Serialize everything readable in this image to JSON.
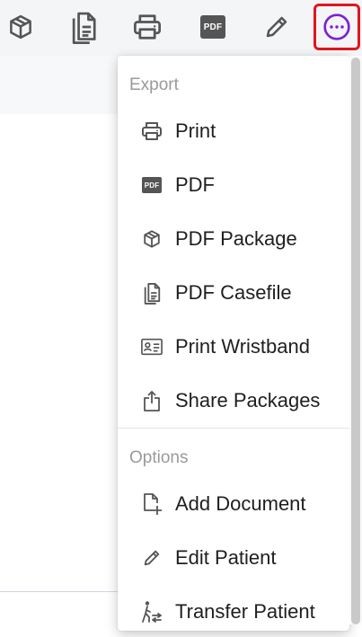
{
  "toolbar": {
    "buttons": [
      {
        "icon": "package-icon"
      },
      {
        "icon": "casefile-icon"
      },
      {
        "icon": "printer-icon"
      },
      {
        "icon": "pdf-icon",
        "badge_text": "PDF"
      },
      {
        "icon": "pencil-icon"
      },
      {
        "icon": "more-horizontal-icon",
        "highlight_color": "#e0161f",
        "accent_color": "#7b22d4"
      }
    ]
  },
  "menu": {
    "export_title": "Export",
    "export_items": [
      {
        "label": "Print",
        "icon": "printer-icon"
      },
      {
        "label": "PDF",
        "icon": "pdf-icon",
        "badge_text": "PDF"
      },
      {
        "label": "PDF Package",
        "icon": "package-icon"
      },
      {
        "label": "PDF Casefile",
        "icon": "casefile-icon"
      },
      {
        "label": "Print Wristband",
        "icon": "id-card-icon"
      },
      {
        "label": "Share Packages",
        "icon": "share-icon"
      }
    ],
    "options_title": "Options",
    "options_items": [
      {
        "label": "Add Document",
        "icon": "add-document-icon"
      },
      {
        "label": "Edit Patient",
        "icon": "pencil-icon"
      },
      {
        "label": "Transfer Patient",
        "icon": "transfer-patient-icon"
      }
    ]
  },
  "colors": {
    "toolbar_bg": "#f4f5f7",
    "icon": "#555555",
    "section_title": "#9a9a9a"
  }
}
